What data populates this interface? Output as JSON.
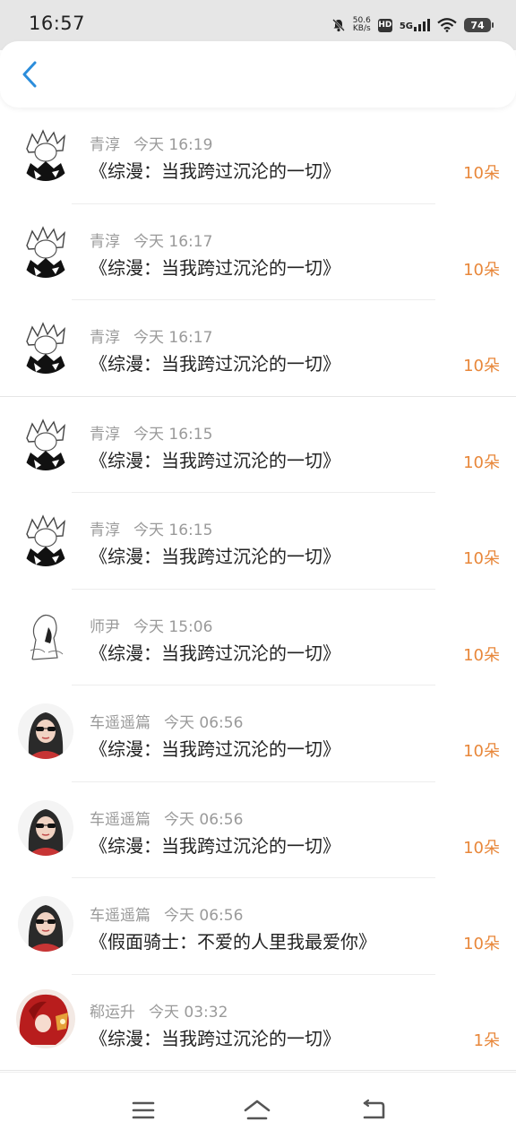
{
  "status_bar": {
    "time": "16:57",
    "net_speed_value": "50.6",
    "net_speed_unit": "KB/s",
    "hd_label": "HD",
    "signal_label": "5G",
    "battery_level": "74"
  },
  "colors": {
    "accent_back": "#2b8ddb",
    "gift_count": "#e8873a"
  },
  "records": [
    {
      "user": "青淳",
      "time": "今天 16:19",
      "title": "《综漫：当我跨过沉沦的一切》",
      "count": "10朵",
      "avatar": "sketch-avatar"
    },
    {
      "user": "青淳",
      "time": "今天 16:17",
      "title": "《综漫：当我跨过沉沦的一切》",
      "count": "10朵",
      "avatar": "sketch-avatar"
    },
    {
      "user": "青淳",
      "time": "今天 16:17",
      "title": "《综漫：当我跨过沉沦的一切》",
      "count": "10朵",
      "avatar": "sketch-avatar"
    },
    {
      "user": "青淳",
      "time": "今天 16:15",
      "title": "《综漫：当我跨过沉沦的一切》",
      "count": "10朵",
      "avatar": "sketch-avatar"
    },
    {
      "user": "青淳",
      "time": "今天 16:15",
      "title": "《综漫：当我跨过沉沦的一切》",
      "count": "10朵",
      "avatar": "sketch-avatar"
    },
    {
      "user": "师尹",
      "time": "今天 15:06",
      "title": "《综漫：当我跨过沉沦的一切》",
      "count": "10朵",
      "avatar": "line-drawing-avatar"
    },
    {
      "user": "车遥遥篇",
      "time": "今天 06:56",
      "title": "《综漫：当我跨过沉沦的一切》",
      "count": "10朵",
      "avatar": "girl-sunglasses-avatar"
    },
    {
      "user": "车遥遥篇",
      "time": "今天 06:56",
      "title": "《综漫：当我跨过沉沦的一切》",
      "count": "10朵",
      "avatar": "girl-sunglasses-avatar"
    },
    {
      "user": "车遥遥篇",
      "time": "今天 06:56",
      "title": "《假面骑士：不爱的人里我最爱你》",
      "count": "10朵",
      "avatar": "girl-sunglasses-avatar"
    },
    {
      "user": "郗运升",
      "time": "今天 03:32",
      "title": "《综漫：当我跨过沉沦的一切》",
      "count": "1朵",
      "avatar": "red-hair-avatar"
    }
  ],
  "nav": {
    "icons": [
      "menu-icon",
      "home-icon",
      "back-nav-icon"
    ]
  }
}
